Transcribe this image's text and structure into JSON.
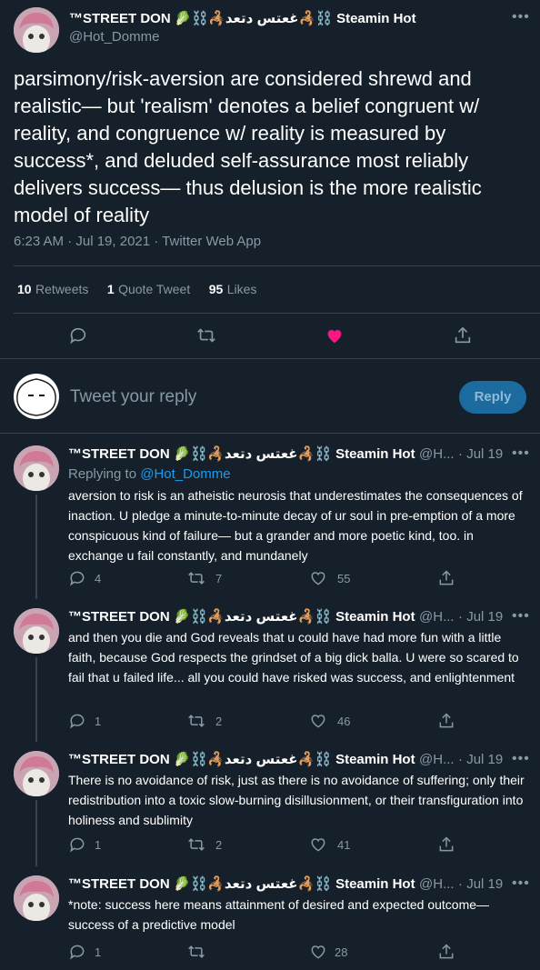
{
  "main_tweet": {
    "display_name": "™STREET DON 🥬⛓️🦂غعتس دتعد🦂⛓️ Steamin Hot",
    "handle": "@Hot_Domme",
    "text": "parsimony/risk-aversion are considered shrewd and realistic— but 'realism' denotes a belief congruent w/ reality, and congruence w/ reality is measured by success*, and deluded self-assurance most reliably delivers success— thus delusion is the more realistic model of reality",
    "timestamp": "6:23 AM · Jul 19, 2021 · Twitter Web App",
    "retweets": "10",
    "retweets_label": "Retweets",
    "quotes": "1",
    "quotes_label": "Quote Tweet",
    "likes": "95",
    "likes_label": "Likes"
  },
  "compose": {
    "placeholder": "Tweet your reply",
    "button": "Reply"
  },
  "replies": [
    {
      "display_name": "™STREET DON 🥬⛓️🦂غعتس دتعد🦂⛓️ Steamin Hot",
      "handle": "@H...",
      "time": "· Jul 19",
      "replying_prefix": "Replying to ",
      "replying_to": "@Hot_Domme",
      "text": "aversion to risk is an atheistic neurosis that underestimates the consequences of inaction. U pledge a minute-to-minute decay of ur soul in pre-emption of a more conspicuous kind of failure— but a grander and more poetic kind, too. in exchange u fail constantly, and mundanely",
      "reply_count": "4",
      "retweet_count": "7",
      "like_count": "55"
    },
    {
      "display_name": "™STREET DON 🥬⛓️🦂غعتس دتعد🦂⛓️ Steamin Hot",
      "handle": "@H...",
      "time": "· Jul 19",
      "text": "and then you die and God reveals that u could have had more fun with a little faith, because God respects the grindset of a big dick balla. U were so scared to fail that u failed life... all you could have risked was success, and enlightenment",
      "reply_count": "1",
      "retweet_count": "2",
      "like_count": "46"
    },
    {
      "display_name": "™STREET DON 🥬⛓️🦂غعتس دتعد🦂⛓️ Steamin Hot",
      "handle": "@H...",
      "time": "· Jul 19",
      "text": "There is no avoidance of risk, just as there is no avoidance of suffering; only their redistribution into a toxic slow-burning disillusionment, or their transfiguration into holiness and sublimity",
      "reply_count": "1",
      "retweet_count": "2",
      "like_count": "41"
    },
    {
      "display_name": "™STREET DON 🥬⛓️🦂غعتس دتعد🦂⛓️ Steamin Hot",
      "handle": "@H...",
      "time": "· Jul 19",
      "text": "*note: success here means attainment of desired and expected outcome— success of a predictive model",
      "reply_count": "1",
      "retweet_count": "",
      "like_count": "28"
    }
  ],
  "icons": {
    "more": "more-icon",
    "reply": "reply-icon",
    "retweet": "retweet-icon",
    "like": "like-icon",
    "share": "share-icon"
  },
  "colors": {
    "background": "#15202b",
    "accent": "#1d9bf0",
    "like_active": "#f91880",
    "muted": "#8899a6"
  }
}
